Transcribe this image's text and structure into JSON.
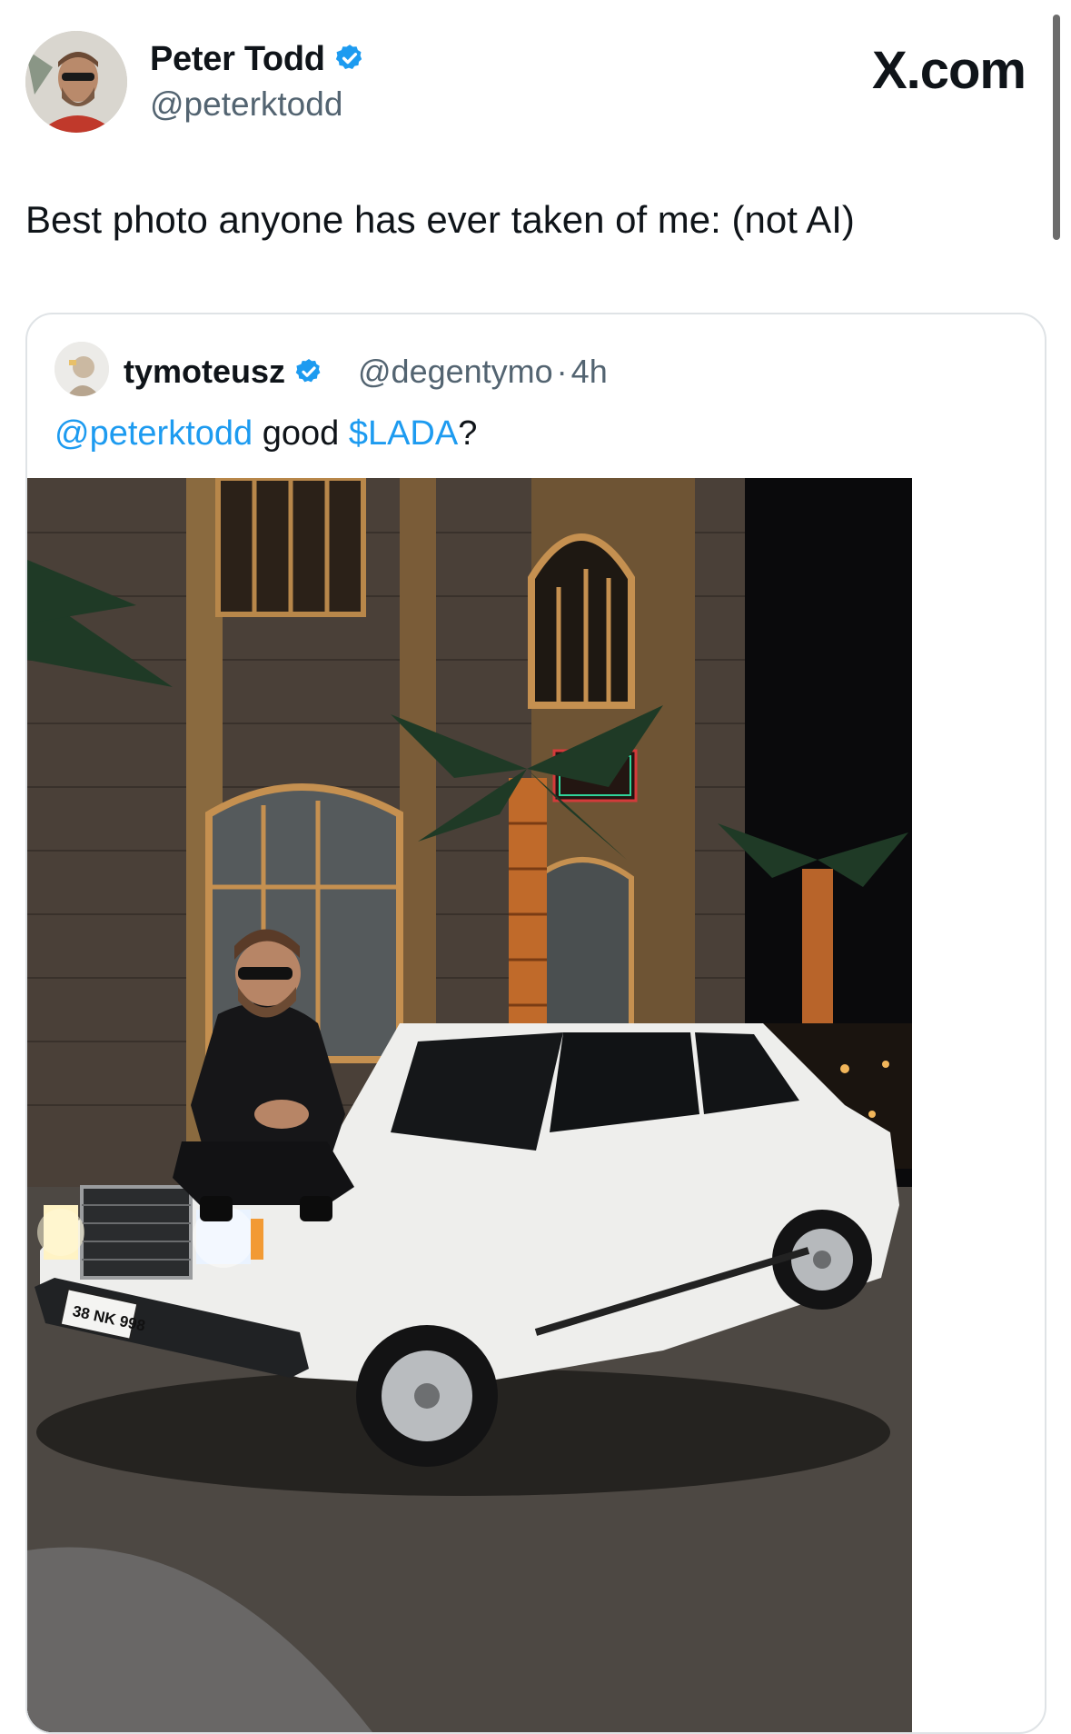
{
  "author": {
    "display_name": "Peter Todd",
    "handle": "@peterktodd",
    "verified": true,
    "avatar_icon": "profile-photo"
  },
  "site": {
    "logo_text": "X.com"
  },
  "tweet": {
    "text": "Best photo anyone has ever taken of me: (not AI)"
  },
  "quoted": {
    "display_name": "tymoteusz",
    "handle": "@degentymo",
    "separator": "·",
    "time": "4h",
    "verified": true,
    "text_mention": "@peterktodd",
    "text_middle": " good ",
    "text_cashtag": "$LADA",
    "text_end": "?",
    "photo": {
      "license_plate": "38 NK 998"
    }
  },
  "colors": {
    "link": "#1d9bf0",
    "verified_badge": "#1d9bf0",
    "secondary_text": "#536471"
  }
}
